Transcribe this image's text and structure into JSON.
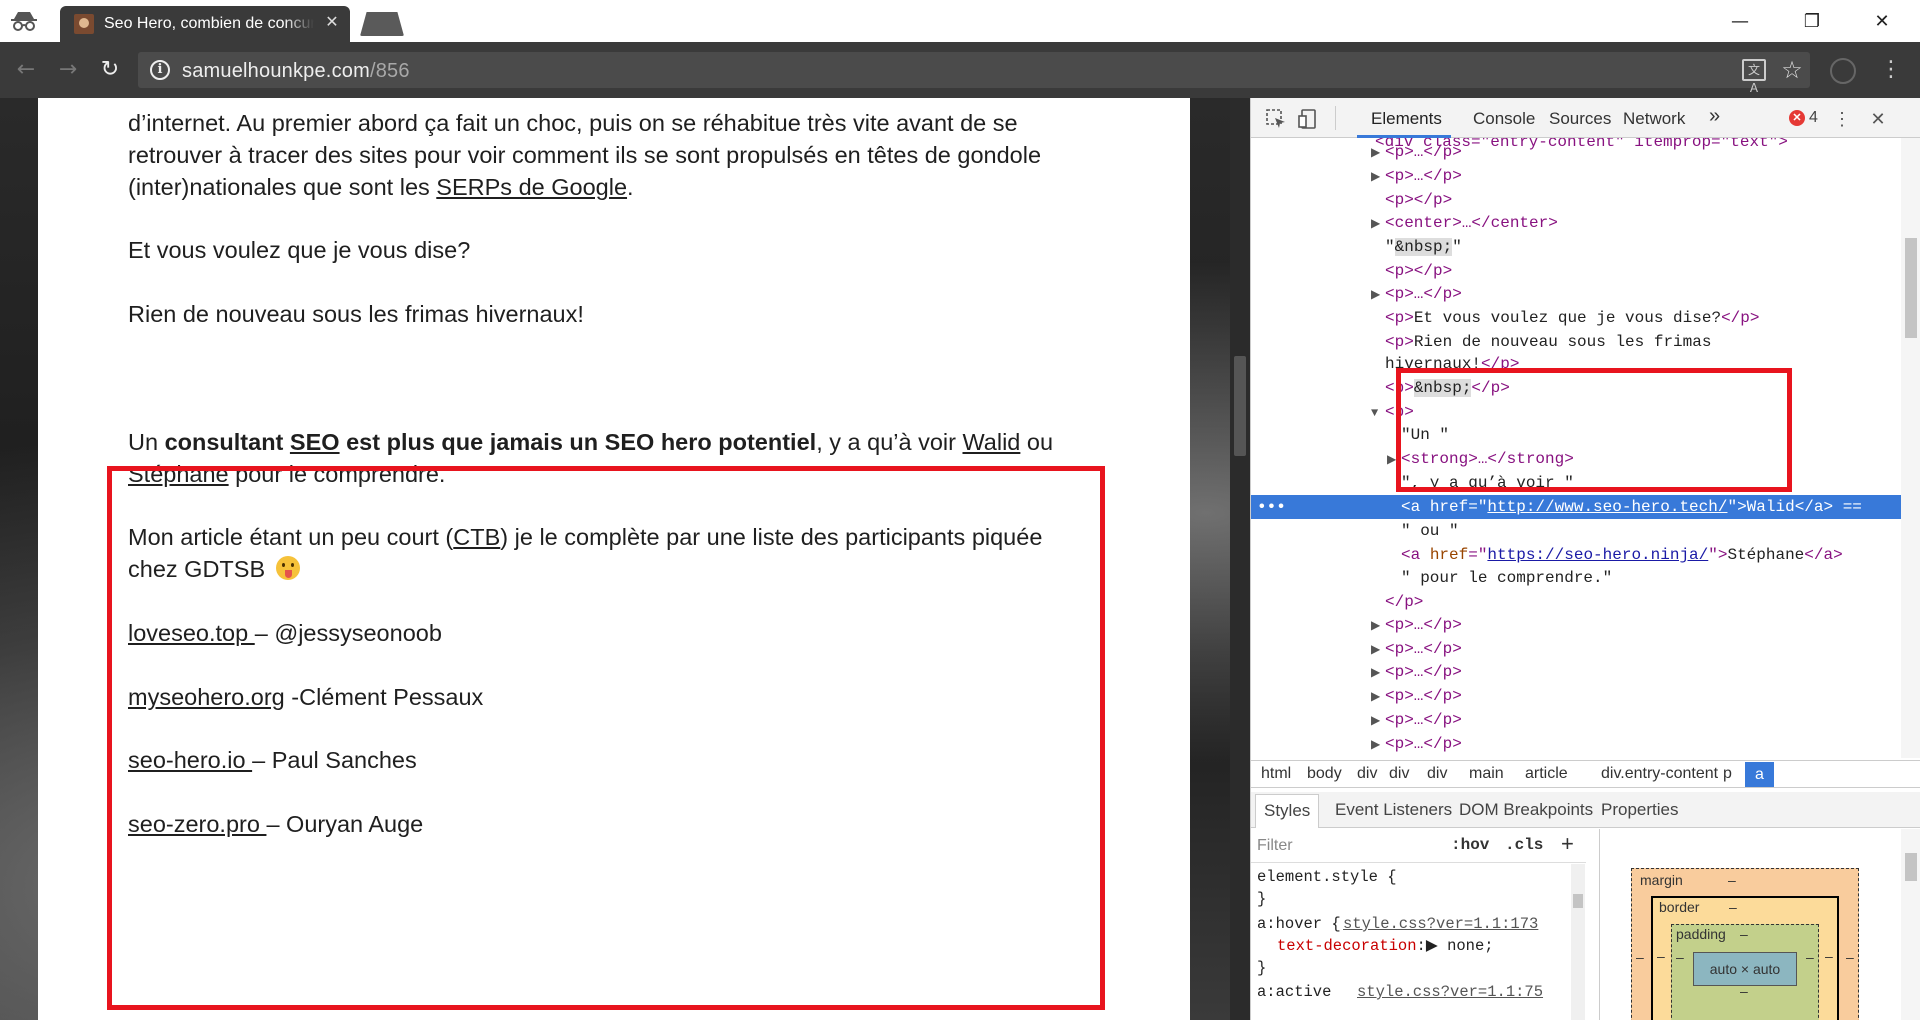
{
  "browser": {
    "tab": {
      "title": "Seo Hero, combien de concurrents ?",
      "close_glyph": "✕"
    },
    "window_controls": {
      "minimize": "—",
      "restore": "❐",
      "close": "✕"
    },
    "nav": {
      "back": "←",
      "forward": "→",
      "reload": "↻"
    },
    "url": {
      "host": "samuelhounkpe.com",
      "path": "/856"
    },
    "icons": {
      "translate_glyph": "文A",
      "star_glyph": "☆",
      "menu_glyph": "⋮"
    }
  },
  "page": {
    "intro_lines": [
      "d’internet. Au premier abord ça fait un choc, puis on se réhabitue très vite avant de se",
      "retrouver à tracer des sites pour voir comment ils se sont propulsés en têtes de gondole"
    ],
    "line3_prefix": "(inter)nationales que sont les ",
    "line3_link": "SERPs de Google",
    "line3_suffix": ".",
    "para2": "Et vous voulez que je vous dise?",
    "para3": "Rien de nouveau sous les frimas hivernaux!",
    "hl_p1_a": "Un ",
    "hl_p1_strong_a": "consultant ",
    "hl_p1_strong_link": "SEO",
    "hl_p1_strong_b": " est plus que jamais un SEO hero potentiel",
    "hl_p1_b": ", y a qu’à voir ",
    "hl_p1_link1": "Walid",
    "hl_p1_c": " ou",
    "hl_p1_link2": "Stéphane",
    "hl_p1_d": " pour le comprendre.",
    "hl_p2_a": "Mon article étant un peu court (",
    "hl_p2_link": "CTB",
    "hl_p2_b": ") je le complète par une liste des participants piquée",
    "hl_p2_c": "chez GDTSB ",
    "participants": [
      {
        "site": "loveseo.top ",
        "sep": " – @jessyseonoob"
      },
      {
        "site": "myseohero.org",
        "sep": "  -Clément Pessaux"
      },
      {
        "site": "seo-hero.io ",
        "sep": "– Paul Sanches"
      },
      {
        "site": "seo-zero.pro ",
        "sep": "– Ouryan Auge"
      }
    ]
  },
  "devtools": {
    "tabs": [
      "Elements",
      "Console",
      "Sources",
      "Network"
    ],
    "more_glyph": "»",
    "error_count": "4",
    "dom_lines": {
      "top_cut": "<div class=\"entry-content\" itemprop=\"text\">",
      "p_collapsed": "<p>…</p>",
      "p_empty": "<p></p>",
      "center": "<center>…</center>",
      "nbsp_text": "&nbsp;",
      "p_et_vous": "Et vous voulez que je vous dise?",
      "p_rien_1": "Rien de nouveau sous les frimas",
      "p_rien_2": "hivernaux!",
      "un": "\"Un \"",
      "strong": "<strong>…</strong>",
      "y_a_qu_a": "\", y a qu’à voir \"",
      "href1": "http://www.seo-hero.tech/",
      "walid": "Walid",
      "ou": "\" ou \"",
      "href2": "https://seo-hero.ninja/",
      "stephane": "Stéphane",
      "pour": "\" pour le comprendre.\""
    },
    "breadcrumbs": [
      "html",
      "body",
      "div",
      "div",
      "div",
      "main",
      "article",
      "div.entry-content",
      "p",
      "a"
    ],
    "styles_tabs": [
      "Styles",
      "Event Listeners",
      "DOM Breakpoints",
      "Properties"
    ],
    "filter_placeholder": "Filter",
    "hov": ":hov",
    "cls": ".cls",
    "add": "+",
    "styles": {
      "element_style": "element.style {",
      "close_brace": "}",
      "hover_selector": "a:hover {",
      "hover_source": "style.css?ver=1.1:173",
      "hover_prop": "text-decoration",
      "hover_value": "none;",
      "active_selector": "a:active",
      "active_source": "style.css?ver=1.1:75"
    },
    "box_model": {
      "margin": "margin",
      "border": "border",
      "padding": "padding",
      "dash": "–",
      "content": "auto × auto"
    }
  },
  "colors": {
    "highlight_border": "#e8141e",
    "selection": "#3879d9"
  }
}
